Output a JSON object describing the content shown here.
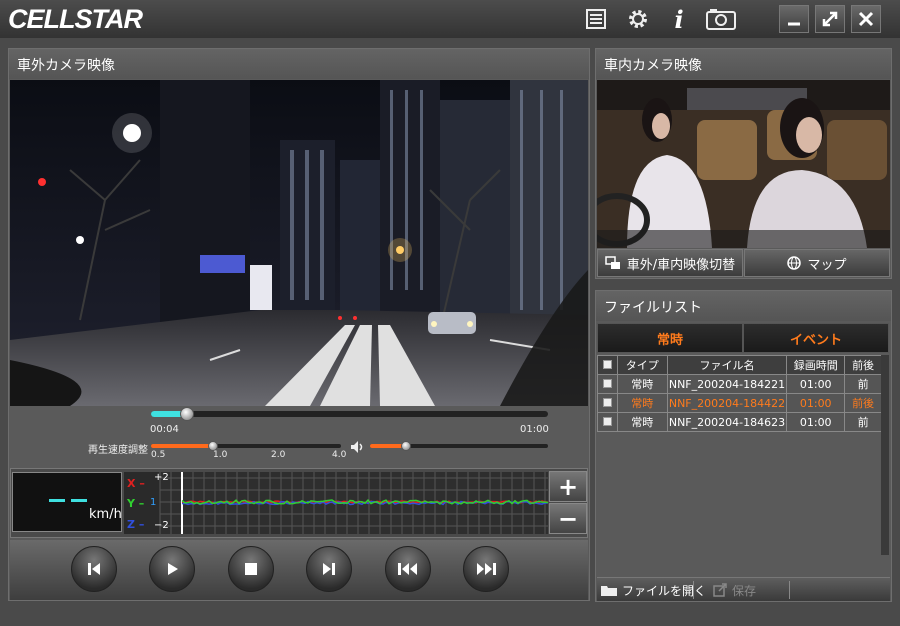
{
  "app": {
    "logo": "CELLSTAR"
  },
  "toolbar": {
    "icons": [
      "list-icon",
      "gear-icon",
      "info-icon",
      "camera-icon"
    ],
    "info_glyph": "i"
  },
  "window": {
    "minimize": "_",
    "maximize": "⤢",
    "close": "✕"
  },
  "outside_panel": {
    "title": "車外カメラ映像",
    "elapsed": "00:04",
    "duration": "01:00",
    "progress": 0.09,
    "speed_label": "再生速度調整",
    "speed_ticks": [
      "0.5",
      "1.0",
      "2.0",
      "4.0"
    ],
    "speed_value": 1.0,
    "volume": 0.2
  },
  "gsensor": {
    "speed_unit": "km/h",
    "axes": [
      {
        "label": "X",
        "color": "#e02020"
      },
      {
        "label": "Y",
        "color": "#30d030"
      },
      {
        "label": "Z",
        "color": "#3050e0"
      }
    ],
    "scale_max": "+2",
    "scale_mid": "1",
    "scale_min": "−2",
    "zoom_in": "+",
    "zoom_out": "−"
  },
  "controls": [
    "skip-previous-icon",
    "play-icon",
    "stop-icon",
    "skip-next-icon",
    "fast-rewind-icon",
    "fast-forward-icon"
  ],
  "inside_panel": {
    "title": "車内カメラ映像",
    "switch_label": "車外/車内映像切替",
    "map_label": "マップ"
  },
  "file_list": {
    "title": "ファイルリスト",
    "tabs": [
      "常時",
      "イベント"
    ],
    "columns": [
      "タイプ",
      "ファイル名",
      "録画時間",
      "前後"
    ],
    "rows": [
      {
        "type": "常時",
        "file": "NNF_200204-184221",
        "duration": "01:00",
        "side": "前",
        "selected": false
      },
      {
        "type": "常時",
        "file": "NNF_200204-184422",
        "duration": "01:00",
        "side": "前後",
        "selected": true
      },
      {
        "type": "常時",
        "file": "NNF_200204-184623",
        "duration": "01:00",
        "side": "前",
        "selected": false
      }
    ],
    "open_label": "ファイルを開く",
    "save_label": "保存"
  },
  "colors": {
    "accent": "#ff7b1c",
    "cyan": "#3fe0e0"
  }
}
